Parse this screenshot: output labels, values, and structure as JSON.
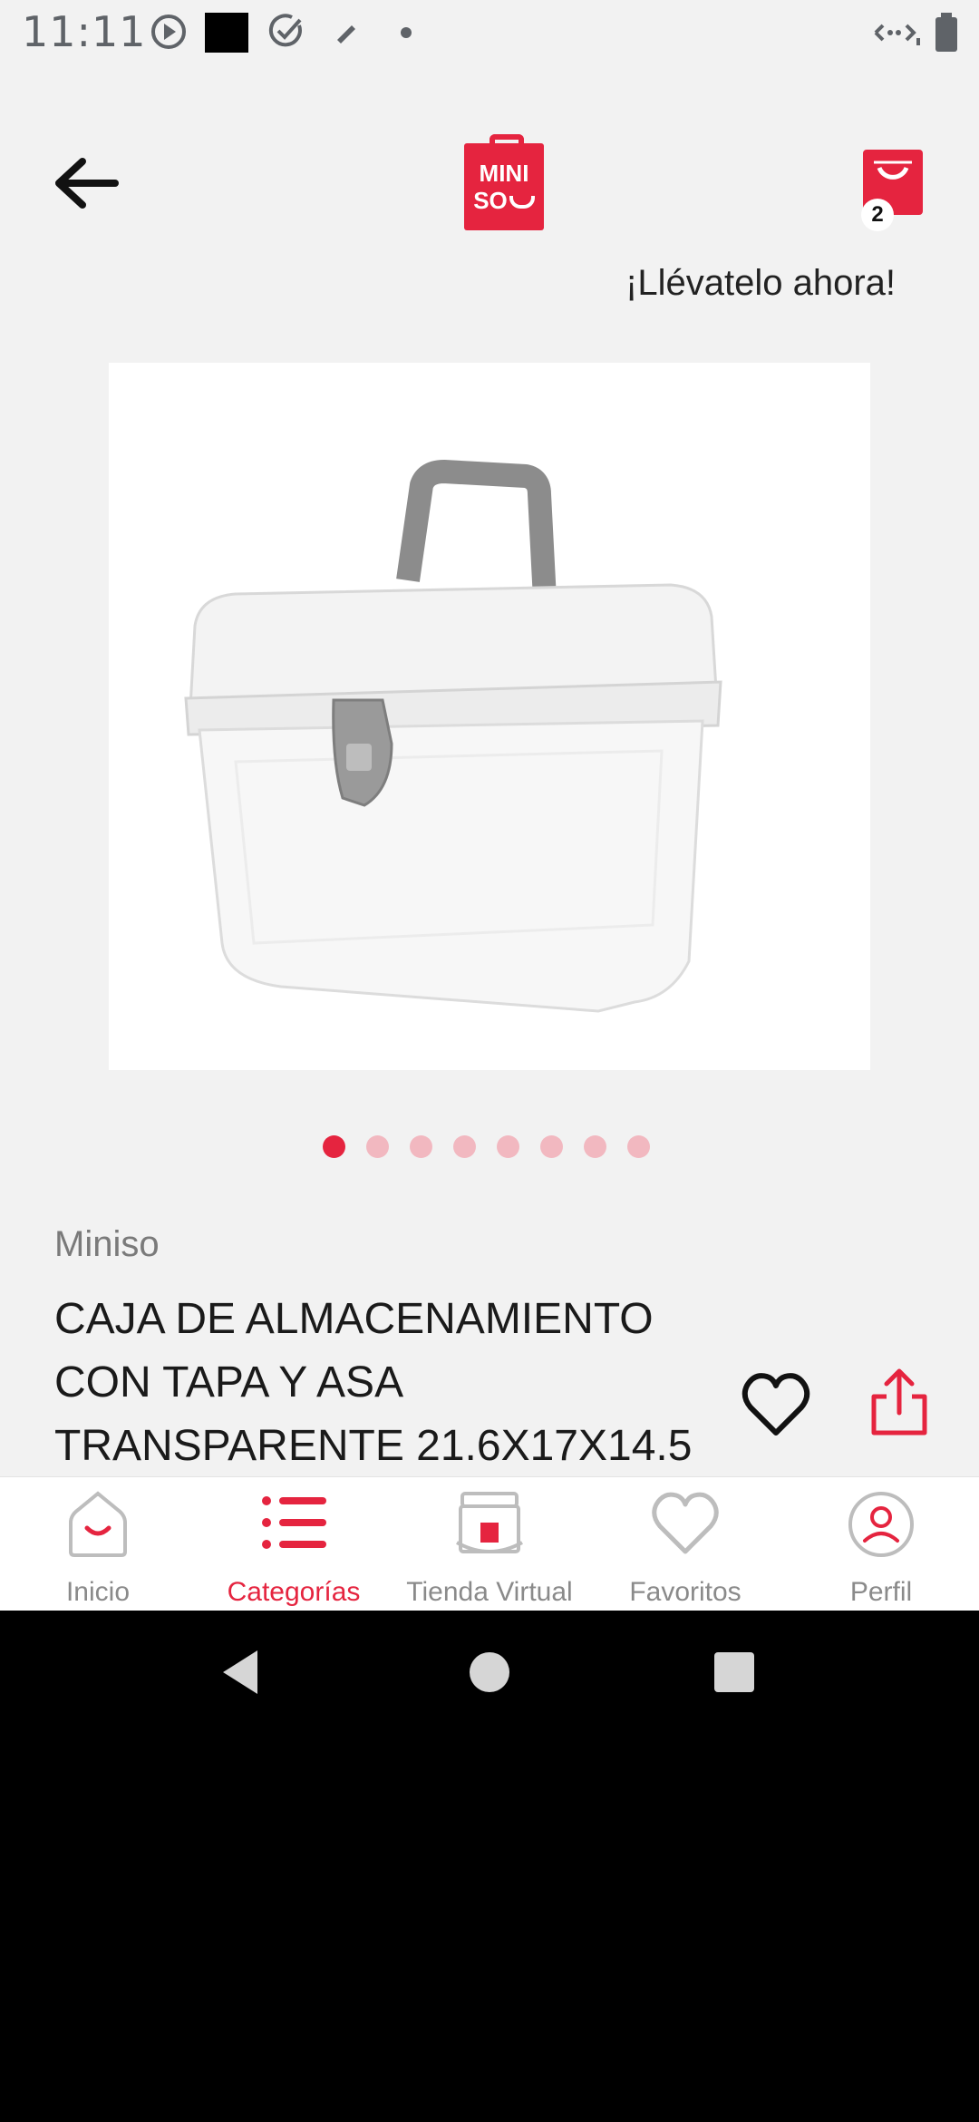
{
  "status_bar": {
    "time": "11:11"
  },
  "header": {
    "logo_text_line1": "MINI",
    "logo_text_line2": "SO",
    "cart_count": "2",
    "tagline": "¡Llévatelo ahora!"
  },
  "carousel": {
    "total_images": 8,
    "active_index": 0
  },
  "product": {
    "brand": "Miniso",
    "title": "CAJA DE ALMACENAMIENTO CON TAPA Y ASA TRANSPARENTE 21.6X17X14.5"
  },
  "bottom_nav": {
    "items": [
      {
        "label": "Inicio",
        "icon": "home-icon"
      },
      {
        "label": "Categorías",
        "icon": "categories-list-icon"
      },
      {
        "label": "Tienda Virtual",
        "icon": "virtual-store-icon"
      },
      {
        "label": "Favoritos",
        "icon": "heart-icon"
      },
      {
        "label": "Perfil",
        "icon": "profile-icon"
      }
    ],
    "active_index": 1
  },
  "colors": {
    "brand_red": "#e5243f",
    "dot_inactive": "#f2b8c0",
    "background": "#f2f2f2"
  }
}
